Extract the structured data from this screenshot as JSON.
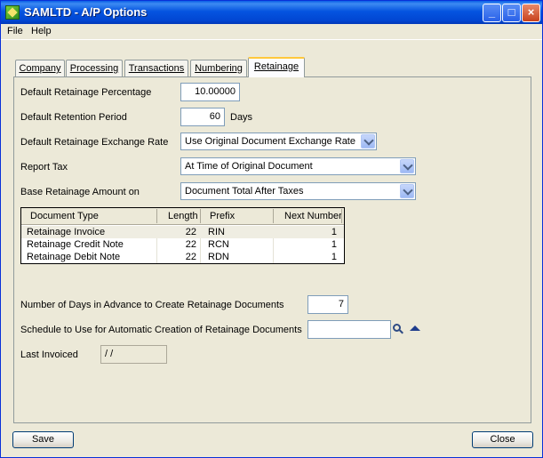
{
  "window": {
    "title": "SAMLTD - A/P Options"
  },
  "menu": {
    "items": [
      "File",
      "Help"
    ]
  },
  "tabs": [
    "Company",
    "Processing",
    "Transactions",
    "Numbering",
    "Retainage"
  ],
  "form": {
    "retainage_pct_label": "Default Retainage Percentage",
    "retainage_pct_value": "10.00000",
    "retention_period_label": "Default Retention Period",
    "retention_period_value": "60",
    "retention_period_unit": "Days",
    "exchange_rate_label": "Default Retainage Exchange Rate",
    "exchange_rate_value": "Use Original Document Exchange Rate",
    "report_tax_label": "Report Tax",
    "report_tax_value": "At Time of Original Document",
    "base_amount_label": "Base Retainage Amount on",
    "base_amount_value": "Document Total After Taxes",
    "days_advance_label": "Number of Days in Advance to Create Retainage Documents",
    "days_advance_value": "7",
    "schedule_label": "Schedule to Use for Automatic Creation of Retainage Documents",
    "schedule_value": "",
    "last_invoiced_label": "Last Invoiced",
    "last_invoiced_value": "/ /"
  },
  "table": {
    "columns": [
      "Document Type",
      "Length",
      "Prefix",
      "Next Number"
    ],
    "rows": [
      [
        "Retainage Invoice",
        "22",
        "RIN",
        "1"
      ],
      [
        "Retainage Credit Note",
        "22",
        "RCN",
        "1"
      ],
      [
        "Retainage Debit Note",
        "22",
        "RDN",
        "1"
      ]
    ]
  },
  "buttons": {
    "save": "Save",
    "close": "Close"
  }
}
